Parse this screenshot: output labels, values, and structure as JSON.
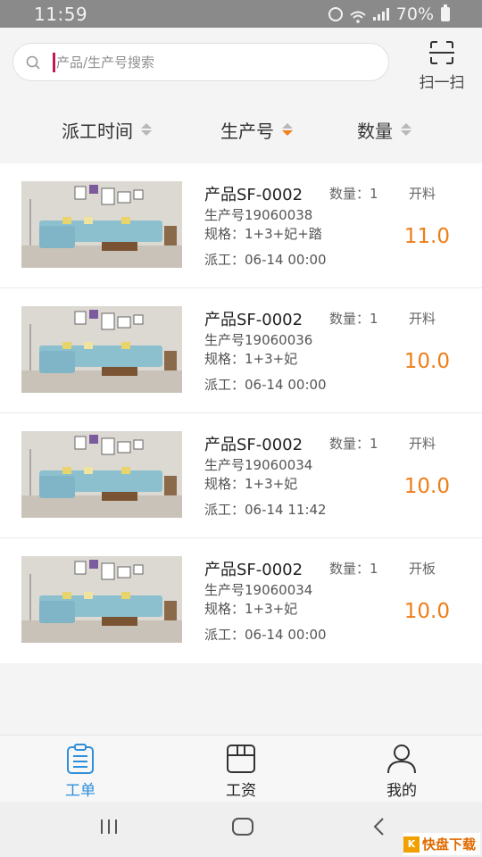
{
  "status_bar": {
    "time": "11:59",
    "network": "4G",
    "battery": "70%"
  },
  "search": {
    "placeholder": "产品/生产号搜索",
    "value": ""
  },
  "scan": {
    "label": "扫一扫"
  },
  "sort": {
    "items": [
      {
        "label": "派工时间",
        "state": "none"
      },
      {
        "label": "生产号",
        "state": "desc"
      },
      {
        "label": "数量",
        "state": "none"
      }
    ]
  },
  "orders": [
    {
      "product": "产品SF-0002",
      "qty": "数量：1",
      "process": "开料",
      "prod_no": "生产号19060038",
      "spec": "规格：1+3+妃+踏",
      "dispatch": "派工：06-14 00:00",
      "wage": "11.0"
    },
    {
      "product": "产品SF-0002",
      "qty": "数量：1",
      "process": "开料",
      "prod_no": "生产号19060036",
      "spec": "规格：1+3+妃",
      "dispatch": "派工：06-14 00:00",
      "wage": "10.0"
    },
    {
      "product": "产品SF-0002",
      "qty": "数量：1",
      "process": "开料",
      "prod_no": "生产号19060034",
      "spec": "规格：1+3+妃",
      "dispatch": "派工：06-14 11:42",
      "wage": "10.0"
    },
    {
      "product": "产品SF-0002",
      "qty": "数量：1",
      "process": "开板",
      "prod_no": "生产号19060034",
      "spec": "规格：1+3+妃",
      "dispatch": "派工：06-14 00:00",
      "wage": "10.0"
    }
  ],
  "tabs": [
    {
      "label": "工单",
      "icon": "clipboard-icon",
      "active": true
    },
    {
      "label": "工资",
      "icon": "wage-box-icon",
      "active": false
    },
    {
      "label": "我的",
      "icon": "user-icon",
      "active": false
    }
  ],
  "watermark": {
    "text": "快盘下载",
    "icon_letter": "K"
  },
  "colors": {
    "accent_orange": "#ef7d18",
    "active_tab_blue": "#2f8ed9",
    "status_bar": "#8a8a8a"
  }
}
